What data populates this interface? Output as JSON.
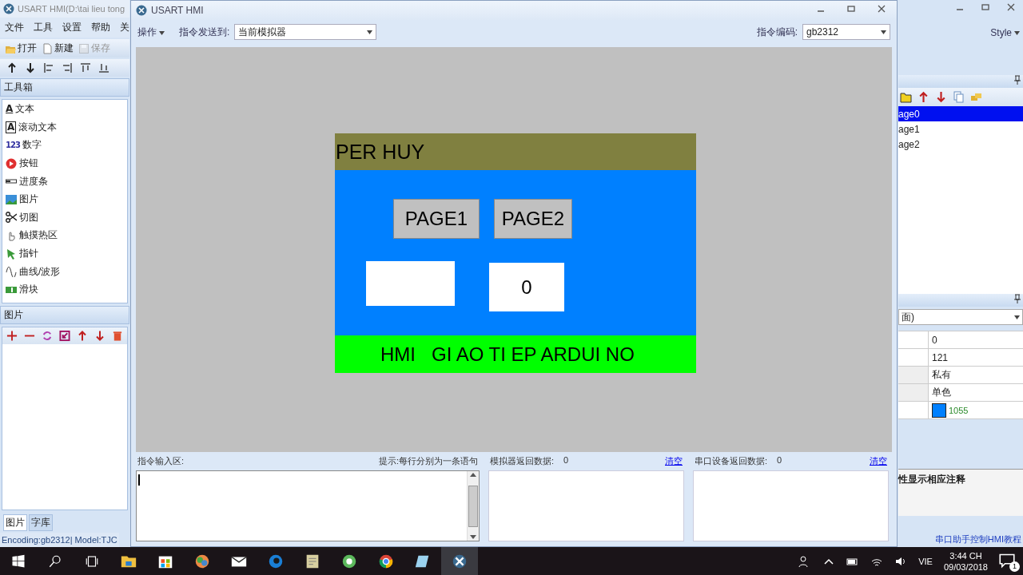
{
  "main_window": {
    "title": "USART HMI(D:\\tai lieu tong",
    "menu": [
      "文件",
      "工具",
      "设置",
      "帮助",
      "关"
    ],
    "toolbar": [
      {
        "label": "打开",
        "kind": "open",
        "disabled": false
      },
      {
        "label": "新建",
        "kind": "new",
        "disabled": false
      },
      {
        "label": "保存",
        "kind": "save",
        "disabled": true
      }
    ],
    "toolbox": {
      "title": "工具箱",
      "items": [
        {
          "label": "文本",
          "kind": "text",
          "glyph": "A"
        },
        {
          "label": "滚动文本",
          "kind": "scroll_text",
          "glyph": "A"
        },
        {
          "label": "数字",
          "kind": "number",
          "glyph": "123"
        },
        {
          "label": "按钮",
          "kind": "button"
        },
        {
          "label": "进度条",
          "kind": "progress"
        },
        {
          "label": "图片",
          "kind": "picture"
        },
        {
          "label": "切图",
          "kind": "crop"
        },
        {
          "label": "触摸热区",
          "kind": "hotspot"
        },
        {
          "label": "指针",
          "kind": "pointer"
        },
        {
          "label": "曲线/波形",
          "kind": "curve"
        },
        {
          "label": "滑块",
          "kind": "slider"
        }
      ]
    },
    "pictures": {
      "title": "图片"
    },
    "bottom_tabs": [
      {
        "label": "图片",
        "selected": true
      },
      {
        "label": "字库",
        "selected": false
      }
    ],
    "status_bar": "Encoding:gb2312| Model:TJC",
    "style_menu": "Style",
    "pages": [
      {
        "label": "age0",
        "selected": true
      },
      {
        "label": "age1",
        "selected": false
      },
      {
        "label": "age2",
        "selected": false
      }
    ],
    "properties": {
      "dropdown": "面)",
      "rows": [
        {
          "value": "0",
          "kind": "text"
        },
        {
          "value": "121",
          "kind": "text"
        },
        {
          "value": "私有",
          "kind": "grey"
        },
        {
          "value": "单色",
          "kind": "grey"
        },
        {
          "value": "1055",
          "kind": "color",
          "color": "#0080ff"
        }
      ]
    },
    "description": "性显示相应注释",
    "right_status": "串口助手控制HMI教程"
  },
  "simulator": {
    "title": "USART HMI",
    "operate_menu": "操作",
    "send_to_label": "指令发送到:",
    "send_to": "当前模拟器",
    "encoding_label": "指令编码:",
    "encoding": "gb2312",
    "screen": {
      "header": "PER HUY",
      "buttons": [
        "PAGE1",
        "PAGE2"
      ],
      "number": "0",
      "footer": "HMI   GI AO TI EP ARDUI NO"
    },
    "input_label": "指令输入区:",
    "hint": "提示:每行分别为一条语句",
    "sim_return_label": "模拟器返回数据:",
    "sim_return_count": "0",
    "device_return_label": "串口设备返回数据:",
    "device_return_count": "0",
    "clear": [
      "清空",
      "清空"
    ]
  },
  "taskbar": {
    "apps": [
      {
        "kind": "explorer",
        "selected": false
      },
      {
        "kind": "store",
        "selected": false
      },
      {
        "kind": "paint",
        "selected": false
      },
      {
        "kind": "mail",
        "selected": false
      },
      {
        "kind": "edge",
        "selected": false
      },
      {
        "kind": "notes",
        "selected": false
      },
      {
        "kind": "ring",
        "selected": false
      },
      {
        "kind": "chrome",
        "selected": false
      },
      {
        "kind": "pad",
        "selected": false
      },
      {
        "kind": "hmi",
        "selected": true
      }
    ],
    "language": "VIE",
    "time": "3:44 CH",
    "date": "09/03/2018",
    "notifications": "1"
  }
}
